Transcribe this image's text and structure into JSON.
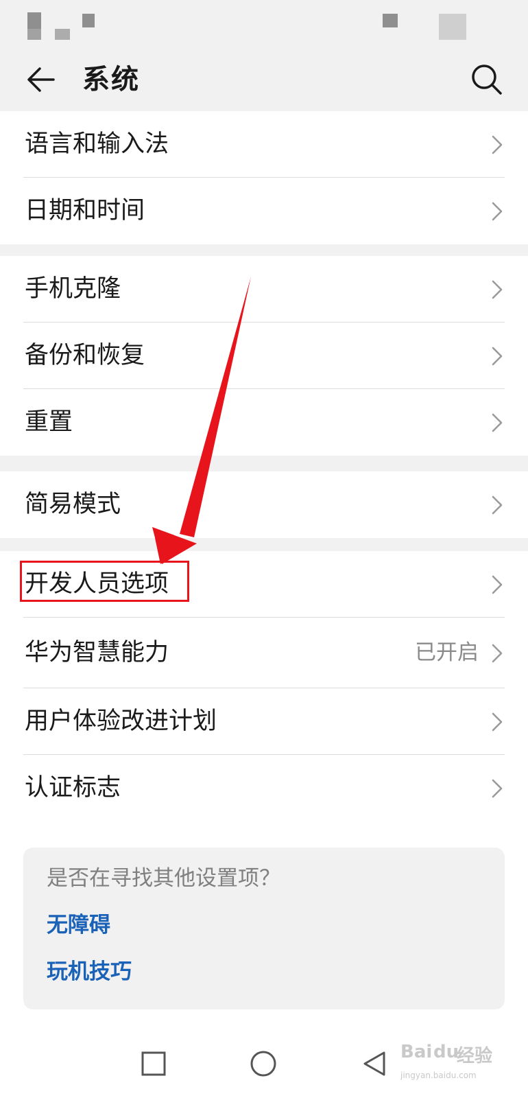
{
  "header": {
    "title": "系统"
  },
  "groups": [
    {
      "items": [
        {
          "label": "语言和输入法"
        },
        {
          "label": "日期和时间"
        }
      ]
    },
    {
      "items": [
        {
          "label": "手机克隆"
        },
        {
          "label": "备份和恢复"
        },
        {
          "label": "重置"
        }
      ]
    },
    {
      "items": [
        {
          "label": "简易模式"
        }
      ]
    },
    {
      "items": [
        {
          "label": "开发人员选项"
        },
        {
          "label": "华为智慧能力",
          "value": "已开启"
        },
        {
          "label": "用户体验改进计划"
        },
        {
          "label": "认证标志"
        }
      ]
    }
  ],
  "suggest": {
    "question": "是否在寻找其他设置项？",
    "links": [
      {
        "label": "无障碍"
      },
      {
        "label": "玩机技巧"
      }
    ]
  },
  "watermark": {
    "brand": "Bai",
    "paw": "du",
    "suffix": "经验",
    "domain": "jingyan.baidu.com"
  },
  "colors": {
    "accent_link": "#1a61b8",
    "annotation_red": "#e8141c",
    "background": "#f1f1f1"
  },
  "icons": {
    "back": "back-arrow-icon",
    "search": "search-icon",
    "chevron": "chevron-right-icon"
  }
}
